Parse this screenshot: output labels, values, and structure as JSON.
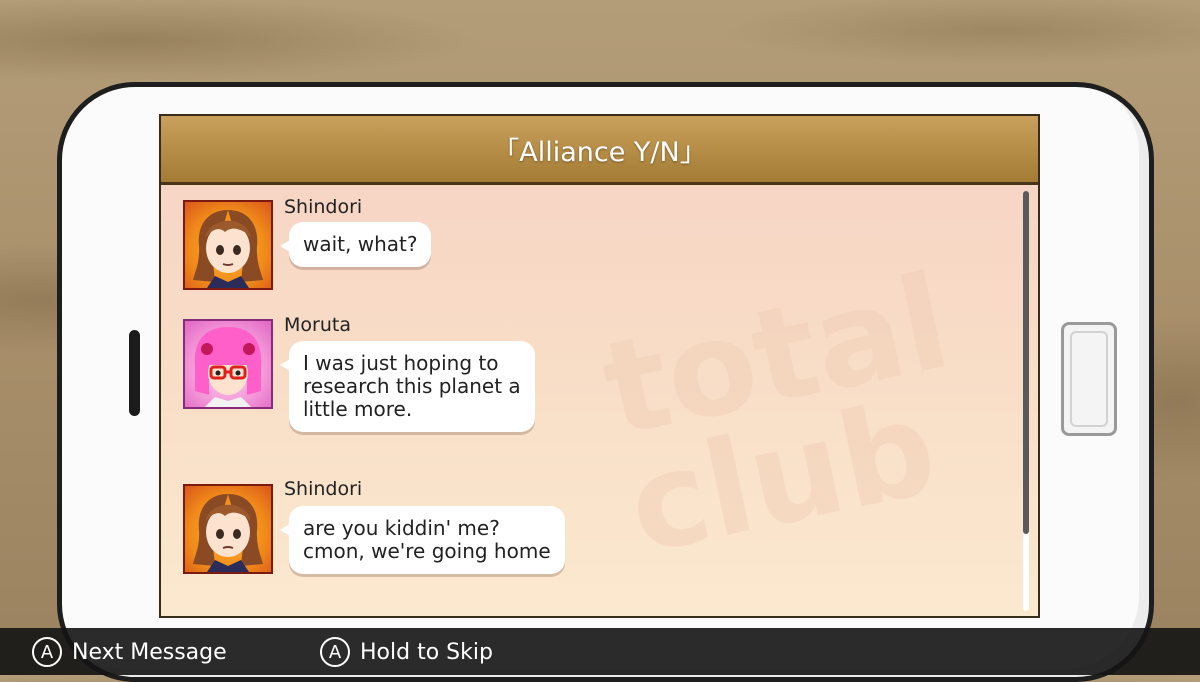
{
  "dialog_title": "「Alliance Y/N」",
  "watermark_text": "total club",
  "messages": [
    {
      "sender": "Shindori",
      "avatar": "shindori-avatar",
      "text": "wait, what?"
    },
    {
      "sender": "Moruta",
      "avatar": "moruta-avatar",
      "text": "I was just hoping to\nresearch this planet a\nlittle more."
    },
    {
      "sender": "Shindori",
      "avatar": "shindori-avatar",
      "text": "are you kiddin' me?\ncmon, we're going home"
    }
  ],
  "controls": {
    "next_button": "A",
    "next_label": "Next Message",
    "skip_button": "A",
    "skip_label": "Hold to Skip"
  },
  "colors": {
    "title_bar": "#b18a44",
    "screen_bg": "#f8dcc6",
    "bottom_bar": "#141414"
  }
}
